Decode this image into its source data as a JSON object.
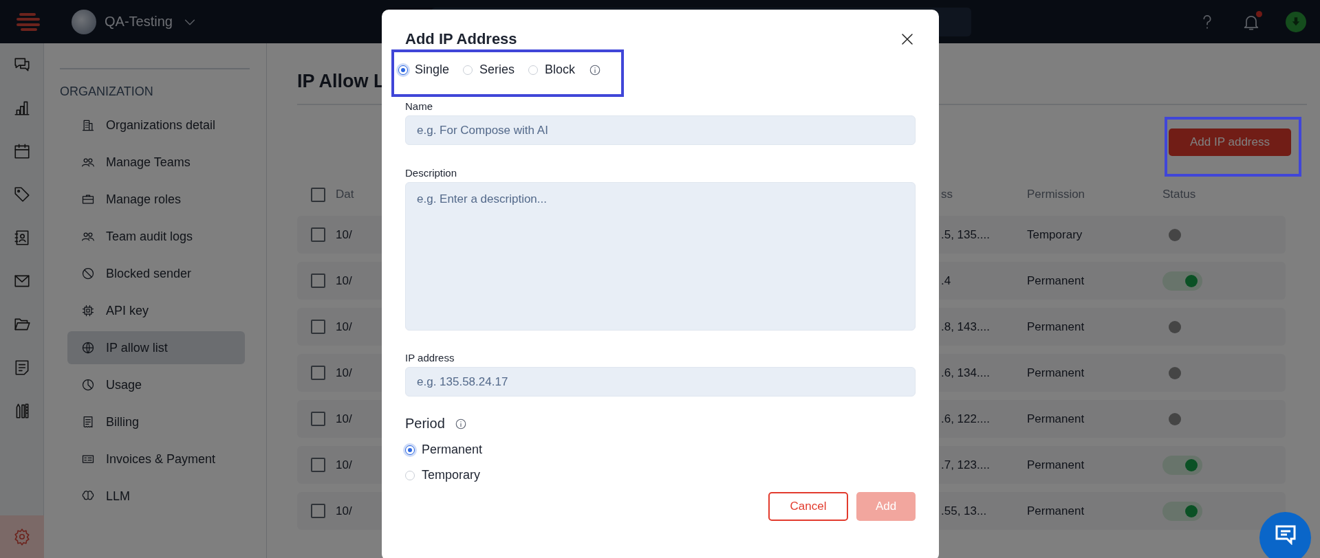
{
  "topbar": {
    "org_name": "QA-Testing",
    "notification_dot": true
  },
  "rail": [
    {
      "kind": "chat",
      "selected": false
    },
    {
      "kind": "chart",
      "selected": false
    },
    {
      "kind": "calendar",
      "selected": false
    },
    {
      "kind": "tag",
      "selected": false
    },
    {
      "kind": "contacts",
      "selected": false
    },
    {
      "kind": "mail",
      "selected": false
    },
    {
      "kind": "folder",
      "selected": false
    },
    {
      "kind": "note",
      "selected": false
    },
    {
      "kind": "tools",
      "selected": false
    },
    {
      "kind": "settings",
      "selected": true
    }
  ],
  "sidebar": {
    "heading": "ORGANIZATION",
    "items": [
      {
        "label": "Organizations detail",
        "kind": "building",
        "selected": false
      },
      {
        "label": "Manage Teams",
        "kind": "people",
        "selected": false
      },
      {
        "label": "Manage roles",
        "kind": "briefcase",
        "selected": false
      },
      {
        "label": "Team audit logs",
        "kind": "people",
        "selected": false
      },
      {
        "label": "Blocked sender",
        "kind": "block",
        "selected": false
      },
      {
        "label": "API key",
        "kind": "chip",
        "selected": false
      },
      {
        "label": "IP allow list",
        "kind": "globe",
        "selected": true
      },
      {
        "label": "Usage",
        "kind": "pie",
        "selected": false
      },
      {
        "label": "Billing",
        "kind": "receipt",
        "selected": false
      },
      {
        "label": "Invoices & Payment",
        "kind": "invoice",
        "selected": false
      },
      {
        "label": "LLM",
        "kind": "brain",
        "selected": false
      }
    ]
  },
  "page": {
    "title": "IP Allow L",
    "add_button": "Add IP address"
  },
  "table": {
    "header_checked": false,
    "columns": [
      "Dat",
      "ss",
      "Permission",
      "Status"
    ],
    "rows": [
      {
        "checked": false,
        "date": "10/",
        "ip": ".5, 135....",
        "permission": "Temporary",
        "on": false
      },
      {
        "checked": false,
        "date": "10/",
        "ip": ".4",
        "permission": "Permanent",
        "on": true
      },
      {
        "checked": false,
        "date": "10/",
        "ip": ".8, 143....",
        "permission": "Permanent",
        "on": false
      },
      {
        "checked": false,
        "date": "10/",
        "ip": ".6, 134....",
        "permission": "Permanent",
        "on": false
      },
      {
        "checked": false,
        "date": "10/",
        "ip": ".6, 122....",
        "permission": "Permanent",
        "on": false
      },
      {
        "checked": false,
        "date": "10/",
        "ip": ".7, 123....",
        "permission": "Permanent",
        "on": true
      },
      {
        "checked": false,
        "date": "10/",
        "ip": ".55, 13...",
        "permission": "Permanent",
        "on": true
      }
    ]
  },
  "dialog": {
    "title": "Add IP Address",
    "types": [
      {
        "label": "Single",
        "selected": true
      },
      {
        "label": "Series",
        "selected": false
      },
      {
        "label": "Block",
        "selected": false
      }
    ],
    "name_label": "Name",
    "name_placeholder": "e.g. For Compose with AI",
    "description_label": "Description",
    "description_placeholder": "e.g. Enter a description...",
    "ip_label": "IP address",
    "ip_placeholder": "e.g. 135.58.24.17",
    "period_label": "Period",
    "periods": [
      {
        "label": "Permanent",
        "selected": true
      },
      {
        "label": "Temporary",
        "selected": false
      }
    ],
    "cancel": "Cancel",
    "add": {
      "label": "Add",
      "disabled": true
    }
  }
}
